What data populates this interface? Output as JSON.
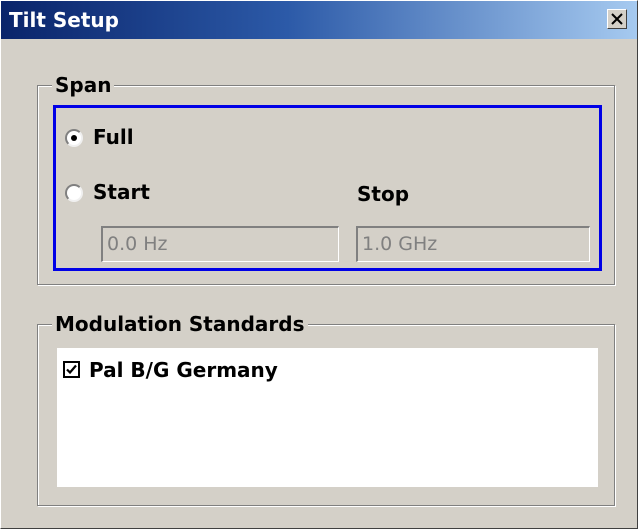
{
  "window": {
    "title": "Tilt Setup"
  },
  "span": {
    "legend": "Span",
    "options": [
      {
        "label": "Full",
        "selected": true
      },
      {
        "label": "Start",
        "selected": false
      }
    ],
    "stop_label": "Stop",
    "start_value": "0.0 Hz",
    "stop_value": "1.0 GHz"
  },
  "modulation": {
    "legend": "Modulation Standards",
    "items": [
      {
        "label": "Pal B/G Germany",
        "checked": true
      }
    ]
  },
  "icons": {
    "close": "close-icon",
    "check": "check-icon"
  }
}
